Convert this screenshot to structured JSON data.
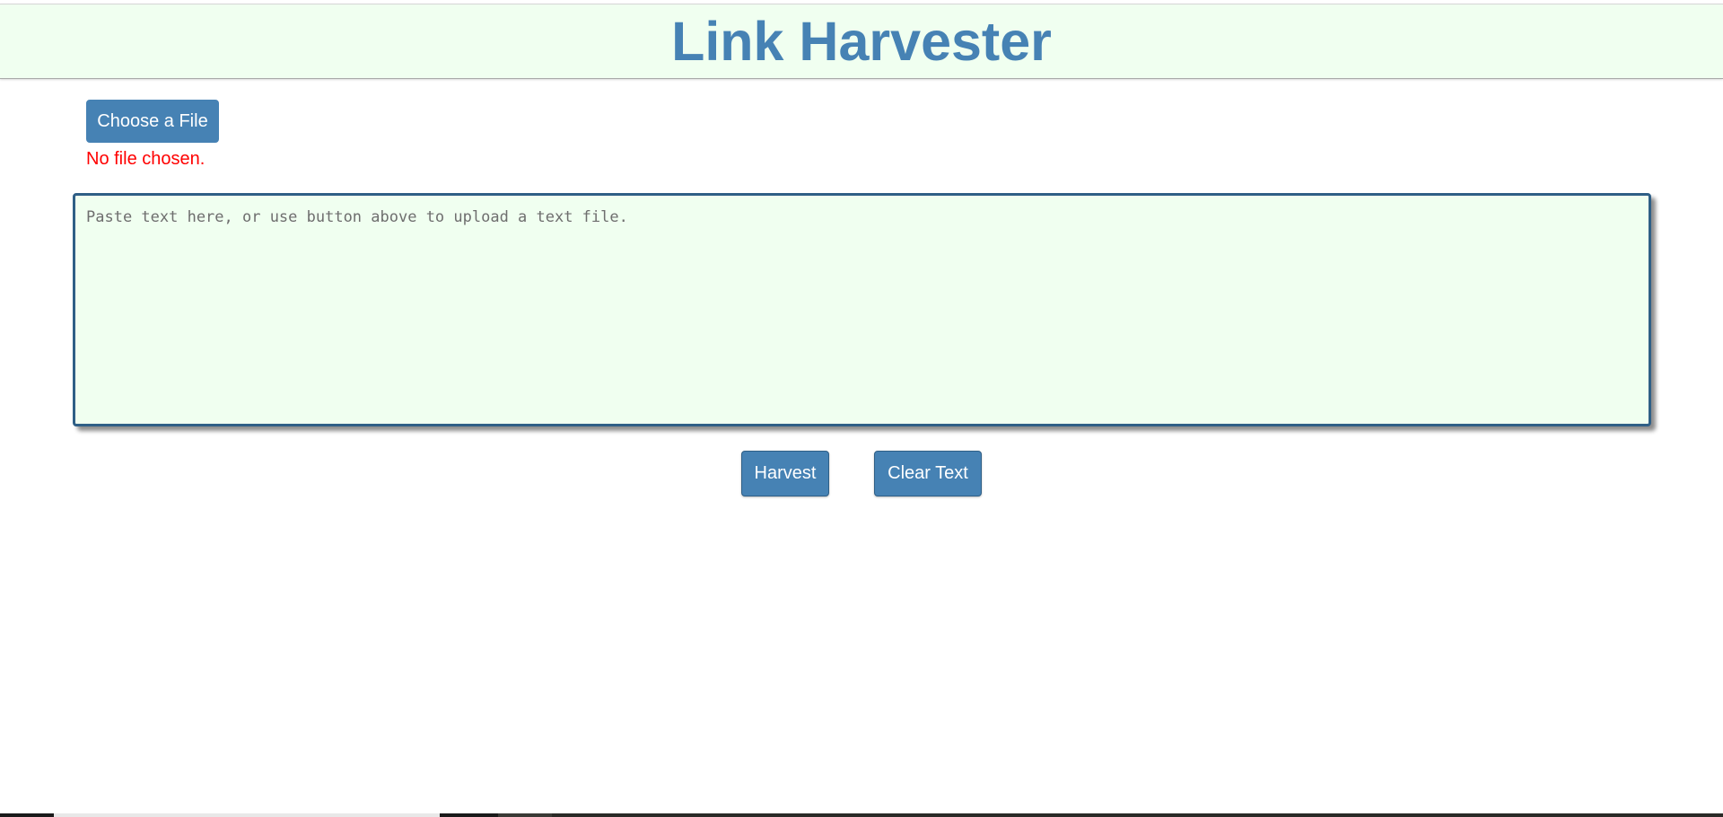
{
  "header": {
    "title": "Link Harvester"
  },
  "file_upload": {
    "button_label": "Choose a File",
    "status": "No file chosen."
  },
  "text_input": {
    "value": "",
    "placeholder": "Paste text here, or use button above to upload a text file."
  },
  "actions": {
    "harvest_label": "Harvest",
    "clear_label": "Clear Text"
  },
  "colors": {
    "accent": "#4682b4",
    "header_background": "#f0fff0",
    "textarea_background": "#f0fff0",
    "error_text": "#ff0000"
  }
}
